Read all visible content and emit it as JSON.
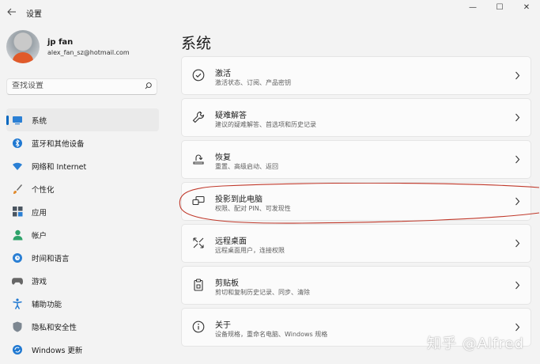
{
  "window": {
    "title": "设置",
    "controls": {
      "minimize": "—",
      "maximize": "☐",
      "close": "✕"
    }
  },
  "profile": {
    "name": "jp fan",
    "email": "alex_fan_sz@hotmail.com"
  },
  "search": {
    "placeholder": "查找设置"
  },
  "sidebar": {
    "items": [
      {
        "label": "系统",
        "icon": "monitor-icon",
        "selected": true
      },
      {
        "label": "蓝牙和其他设备",
        "icon": "bluetooth-icon"
      },
      {
        "label": "网络和 Internet",
        "icon": "wifi-icon"
      },
      {
        "label": "个性化",
        "icon": "brush-icon"
      },
      {
        "label": "应用",
        "icon": "apps-icon"
      },
      {
        "label": "帐户",
        "icon": "account-icon"
      },
      {
        "label": "时间和语言",
        "icon": "globe-clock-icon"
      },
      {
        "label": "游戏",
        "icon": "gamepad-icon"
      },
      {
        "label": "辅助功能",
        "icon": "accessibility-icon"
      },
      {
        "label": "隐私和安全性",
        "icon": "shield-icon"
      },
      {
        "label": "Windows 更新",
        "icon": "update-icon"
      }
    ]
  },
  "main": {
    "title": "系统",
    "cards": [
      {
        "title": "激活",
        "subtitle": "激活状态、订阅、产品密钥",
        "icon": "check-circle-icon"
      },
      {
        "title": "疑难解答",
        "subtitle": "建议的疑难解答、首选项和历史记录",
        "icon": "wrench-icon"
      },
      {
        "title": "恢复",
        "subtitle": "重置、高级启动、返回",
        "icon": "recovery-icon"
      },
      {
        "title": "投影到此电脑",
        "subtitle": "权限、配对 PIN、可发现性",
        "icon": "project-icon"
      },
      {
        "title": "远程桌面",
        "subtitle": "远程桌面用户，连接权限",
        "icon": "remote-desktop-icon"
      },
      {
        "title": "剪贴板",
        "subtitle": "剪切和复制历史记录、同步、清除",
        "icon": "clipboard-icon"
      },
      {
        "title": "关于",
        "subtitle": "设备规格，重命名电脑、Windows 规格",
        "icon": "info-icon"
      }
    ]
  },
  "watermark": "知乎 @Alfred",
  "colors": {
    "accent": "#0067c0",
    "annotation": "#c0392b"
  }
}
